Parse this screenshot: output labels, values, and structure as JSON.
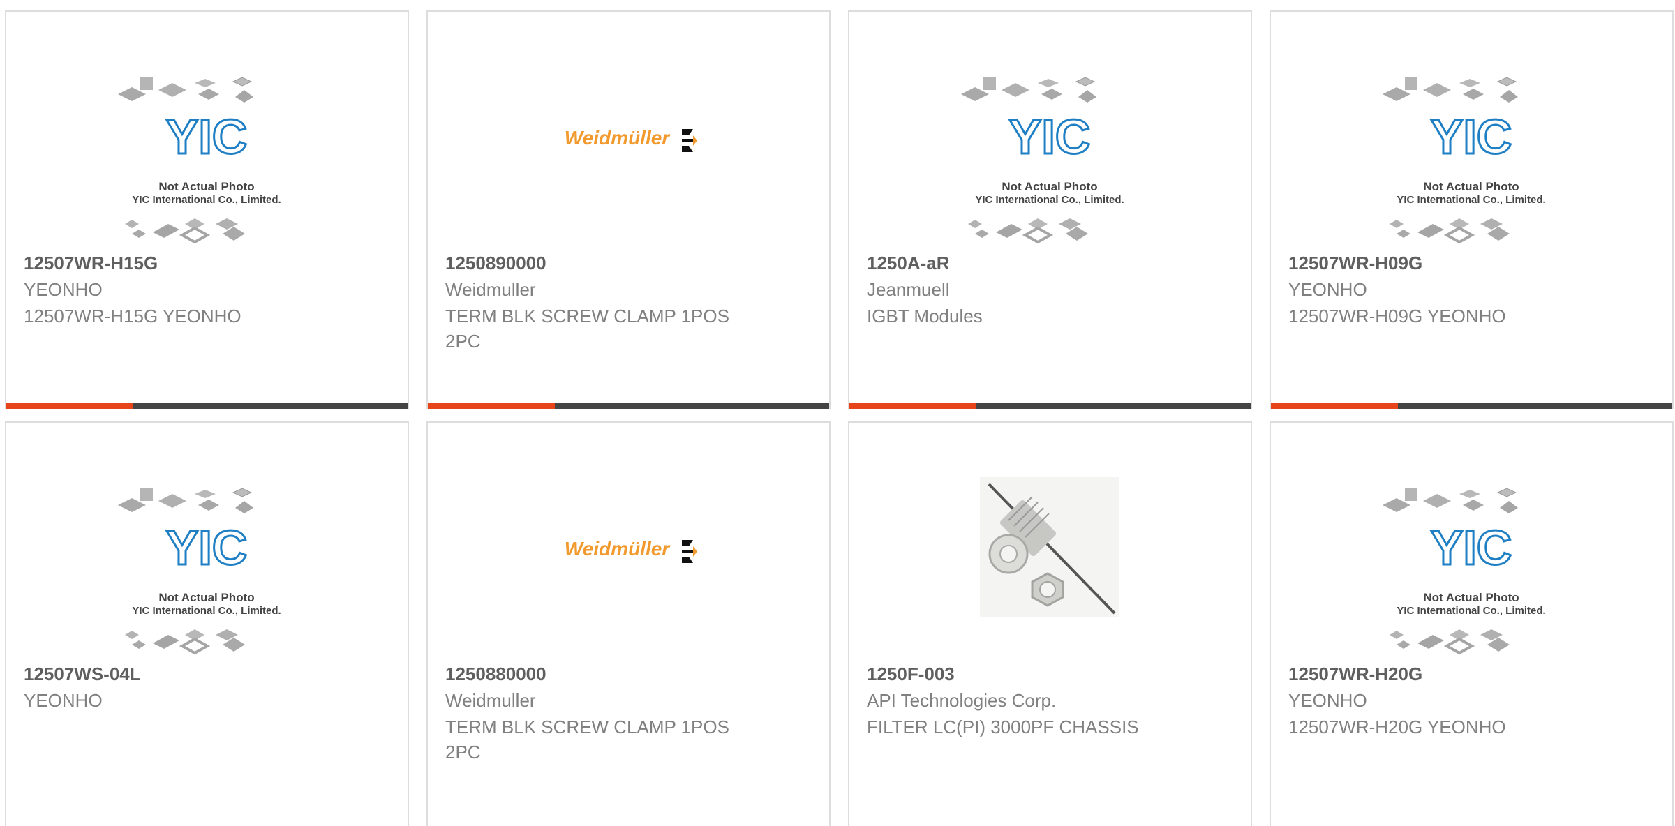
{
  "products": [
    {
      "part_number": "12507WR-H15G",
      "manufacturer": "YEONHO",
      "description": "12507WR-H15G YEONHO",
      "image": {
        "icon": "not-actual-photo-placeholder",
        "caption_line1": "Not Actual Photo",
        "caption_line2": "YIC International Co., Limited.",
        "logo_text": "YIC"
      }
    },
    {
      "part_number": "1250890000",
      "manufacturer": "Weidmuller",
      "description": "TERM BLK SCREW CLAMP 1POS 2PC",
      "image": {
        "icon": "weidmuller-logo",
        "logo_text": "Weidmüller"
      }
    },
    {
      "part_number": "1250A-aR",
      "manufacturer": "Jeanmuell",
      "description": "IGBT Modules",
      "image": {
        "icon": "not-actual-photo-placeholder",
        "caption_line1": "Not Actual Photo",
        "caption_line2": "YIC International Co., Limited.",
        "logo_text": "YIC"
      }
    },
    {
      "part_number": "12507WR-H09G",
      "manufacturer": "YEONHO",
      "description": "12507WR-H09G YEONHO",
      "image": {
        "icon": "not-actual-photo-placeholder",
        "caption_line1": "Not Actual Photo",
        "caption_line2": "YIC International Co., Limited.",
        "logo_text": "YIC"
      }
    },
    {
      "part_number": "12507WS-04L",
      "manufacturer": "YEONHO",
      "description": "",
      "image": {
        "icon": "not-actual-photo-placeholder",
        "caption_line1": "Not Actual Photo",
        "caption_line2": "YIC International Co., Limited.",
        "logo_text": "YIC"
      }
    },
    {
      "part_number": "1250880000",
      "manufacturer": "Weidmuller",
      "description": "TERM BLK SCREW CLAMP 1POS 2PC",
      "image": {
        "icon": "weidmuller-logo",
        "logo_text": "Weidmüller"
      }
    },
    {
      "part_number": "1250F-003",
      "manufacturer": "API Technologies Corp.",
      "description": "FILTER LC(PI) 3000PF CHASSIS",
      "image": {
        "icon": "feedthrough-filter-photo"
      }
    },
    {
      "part_number": "12507WR-H20G",
      "manufacturer": "YEONHO",
      "description": "12507WR-H20G YEONHO",
      "image": {
        "icon": "not-actual-photo-placeholder",
        "caption_line1": "Not Actual Photo",
        "caption_line2": "YIC International Co., Limited.",
        "logo_text": "YIC"
      }
    }
  ],
  "colors": {
    "accent_orange": "#e8441a",
    "bar_dark": "#444444",
    "yic_blue": "#1f7fc4",
    "weidmuller_orange": "#f29a2e"
  }
}
